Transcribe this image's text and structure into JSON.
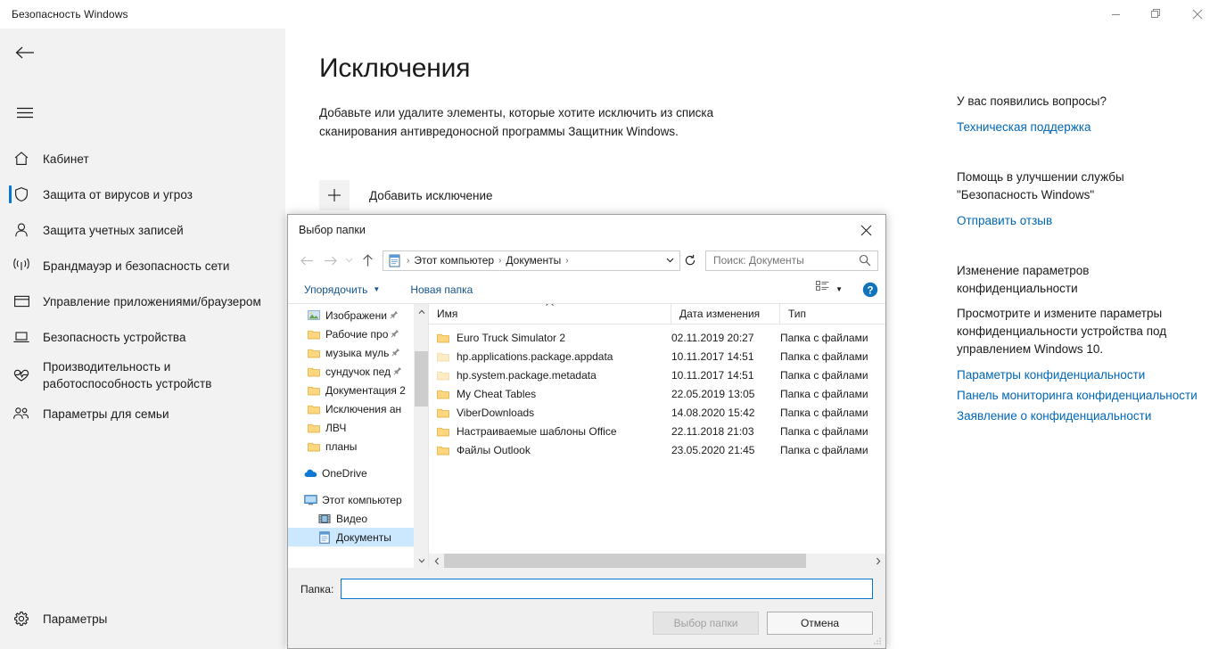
{
  "window": {
    "title": "Безопасность Windows",
    "controls": {
      "minimize": "minimize-icon",
      "restore": "restore-icon",
      "close": "close-icon"
    }
  },
  "sidebar": {
    "back_icon": "back-arrow-icon",
    "menu_icon": "hamburger-menu-icon",
    "items": [
      {
        "label": "Кабинет",
        "icon": "home-icon",
        "selected": false
      },
      {
        "label": "Защита от вирусов и угроз",
        "icon": "shield-icon",
        "selected": true
      },
      {
        "label": "Защита учетных записей",
        "icon": "person-icon",
        "selected": false
      },
      {
        "label": "Брандмауэр и безопасность сети",
        "icon": "wifi-icon",
        "selected": false
      },
      {
        "label": "Управление приложениями/браузером",
        "icon": "window-icon",
        "selected": false
      },
      {
        "label": "Безопасность устройства",
        "icon": "laptop-icon",
        "selected": false
      },
      {
        "label": "Производительность и работоспособность устройств",
        "icon": "heartbeat-icon",
        "selected": false
      },
      {
        "label": "Параметры для семьи",
        "icon": "family-icon",
        "selected": false
      }
    ],
    "settings": {
      "label": "Параметры",
      "icon": "gear-icon"
    },
    "accent_color": "#0078d4",
    "background_color": "#f2f2f2"
  },
  "main": {
    "title": "Исключения",
    "description": "Добавьте или удалите элементы, которые хотите исключить из списка сканирования антивредоносной программы Защитник Windows.",
    "add_button": {
      "label": "Добавить исключение",
      "icon": "plus-icon"
    }
  },
  "help_panel": {
    "blocks": [
      {
        "heading": "У вас появились вопросы?",
        "body": "",
        "links": [
          "Техническая поддержка"
        ]
      },
      {
        "heading": "Помощь в улучшении службы \"Безопасность Windows\"",
        "body": "",
        "links": [
          "Отправить отзыв"
        ]
      },
      {
        "heading": "Изменение параметров конфиденциальности",
        "body": "Просмотрите и измените параметры конфиденциальности устройства под управлением Windows 10.",
        "links": [
          "Параметры конфиденциальности",
          "Панель мониторинга конфиденциальности",
          "Заявление о конфиденциальности"
        ]
      }
    ],
    "link_color": "#0067b8"
  },
  "dialog": {
    "title": "Выбор папки",
    "close_icon": "close-icon",
    "nav": {
      "back_icon": "back-arrow-icon",
      "forward_icon": "forward-arrow-icon",
      "recent_icon": "recent-locations-icon",
      "up_icon": "up-arrow-icon"
    },
    "breadcrumb": {
      "root_icon": "documents-icon",
      "crumbs": [
        "Этот компьютер",
        "Документы"
      ],
      "separator": "›",
      "dropdown_icon": "chevron-down-icon",
      "refresh_icon": "refresh-icon"
    },
    "search": {
      "placeholder": "Поиск: Документы",
      "value": "",
      "icon": "search-icon"
    },
    "toolbar": {
      "organize": "Упорядочить",
      "new_folder": "Новая папка",
      "view_icon": "view-details-icon",
      "help_icon": "help-icon"
    },
    "tree": {
      "quick_items": [
        {
          "label": "Изображени",
          "icon": "pictures-icon",
          "pinned": true,
          "indent": 1
        },
        {
          "label": "Рабочие про",
          "icon": "folder-icon",
          "pinned": true,
          "indent": 1
        },
        {
          "label": "музыка муль",
          "icon": "folder-icon",
          "pinned": true,
          "indent": 1
        },
        {
          "label": "сундучок пед",
          "icon": "folder-icon",
          "pinned": true,
          "indent": 1
        },
        {
          "label": "Документация 2",
          "icon": "folder-icon",
          "pinned": false,
          "indent": 1
        },
        {
          "label": "Исключения ан",
          "icon": "folder-icon",
          "pinned": false,
          "indent": 1
        },
        {
          "label": "ЛВЧ",
          "icon": "folder-icon",
          "pinned": false,
          "indent": 1
        },
        {
          "label": "планы",
          "icon": "folder-icon",
          "pinned": false,
          "indent": 1
        }
      ],
      "roots": [
        {
          "label": "OneDrive",
          "icon": "onedrive-icon",
          "indent": 0,
          "selected": false
        },
        {
          "label": "Этот компьютер",
          "icon": "computer-icon",
          "indent": 0,
          "selected": false
        },
        {
          "label": "Видео",
          "icon": "videos-icon",
          "indent": 1,
          "selected": false
        },
        {
          "label": "Документы",
          "icon": "documents-icon",
          "indent": 1,
          "selected": true
        }
      ]
    },
    "columns": [
      "Имя",
      "Дата изменения",
      "Тип"
    ],
    "sort_indicator": "ascending-caret",
    "files": [
      {
        "name": "Euro Truck Simulator 2",
        "modified": "02.11.2019 20:27",
        "type": "Папка с файлами",
        "hidden": false
      },
      {
        "name": "hp.applications.package.appdata",
        "modified": "10.11.2017 14:51",
        "type": "Папка с файлами",
        "hidden": true
      },
      {
        "name": "hp.system.package.metadata",
        "modified": "10.11.2017 14:51",
        "type": "Папка с файлами",
        "hidden": true
      },
      {
        "name": "My Cheat Tables",
        "modified": "22.05.2019 13:05",
        "type": "Папка с файлами",
        "hidden": false
      },
      {
        "name": "ViberDownloads",
        "modified": "14.08.2020 15:42",
        "type": "Папка с файлами",
        "hidden": false
      },
      {
        "name": "Настраиваемые шаблоны Office",
        "modified": "22.11.2018 21:03",
        "type": "Папка с файлами",
        "hidden": false
      },
      {
        "name": "Файлы Outlook",
        "modified": "23.05.2020 21:45",
        "type": "Папка с файлами",
        "hidden": false
      }
    ],
    "footer": {
      "folder_label": "Папка:",
      "folder_value": "",
      "select_button": "Выбор папки",
      "cancel_button": "Отмена"
    }
  }
}
